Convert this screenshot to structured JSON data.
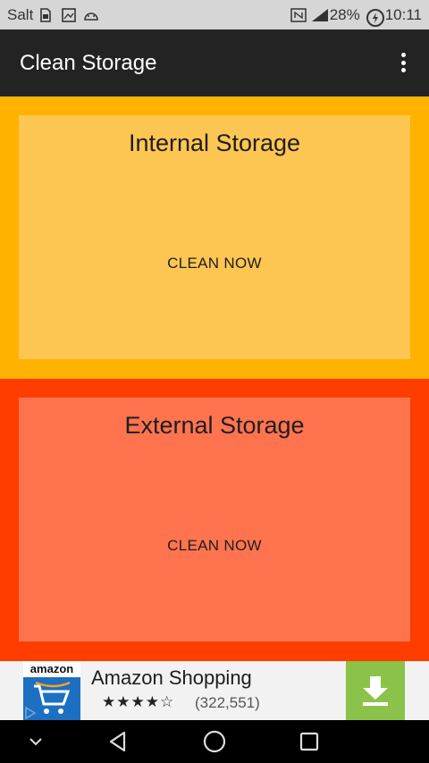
{
  "status_bar": {
    "carrier": "Salt",
    "battery": "28%",
    "time": "10:11"
  },
  "app_bar": {
    "title": "Clean Storage"
  },
  "internal": {
    "title": "Internal Storage",
    "button": "CLEAN NOW"
  },
  "external": {
    "title": "External Storage",
    "button": "CLEAN NOW"
  },
  "ad": {
    "logo_text": "amazon",
    "title": "Amazon Shopping",
    "stars": "★★★★☆",
    "reviews": "(322,551)"
  },
  "colors": {
    "internal_bg": "#ffb300",
    "internal_card": "#fdc652",
    "external_bg": "#ff3d00",
    "external_card": "#ff744f",
    "app_bar": "#232323",
    "download": "#8bc34a"
  }
}
